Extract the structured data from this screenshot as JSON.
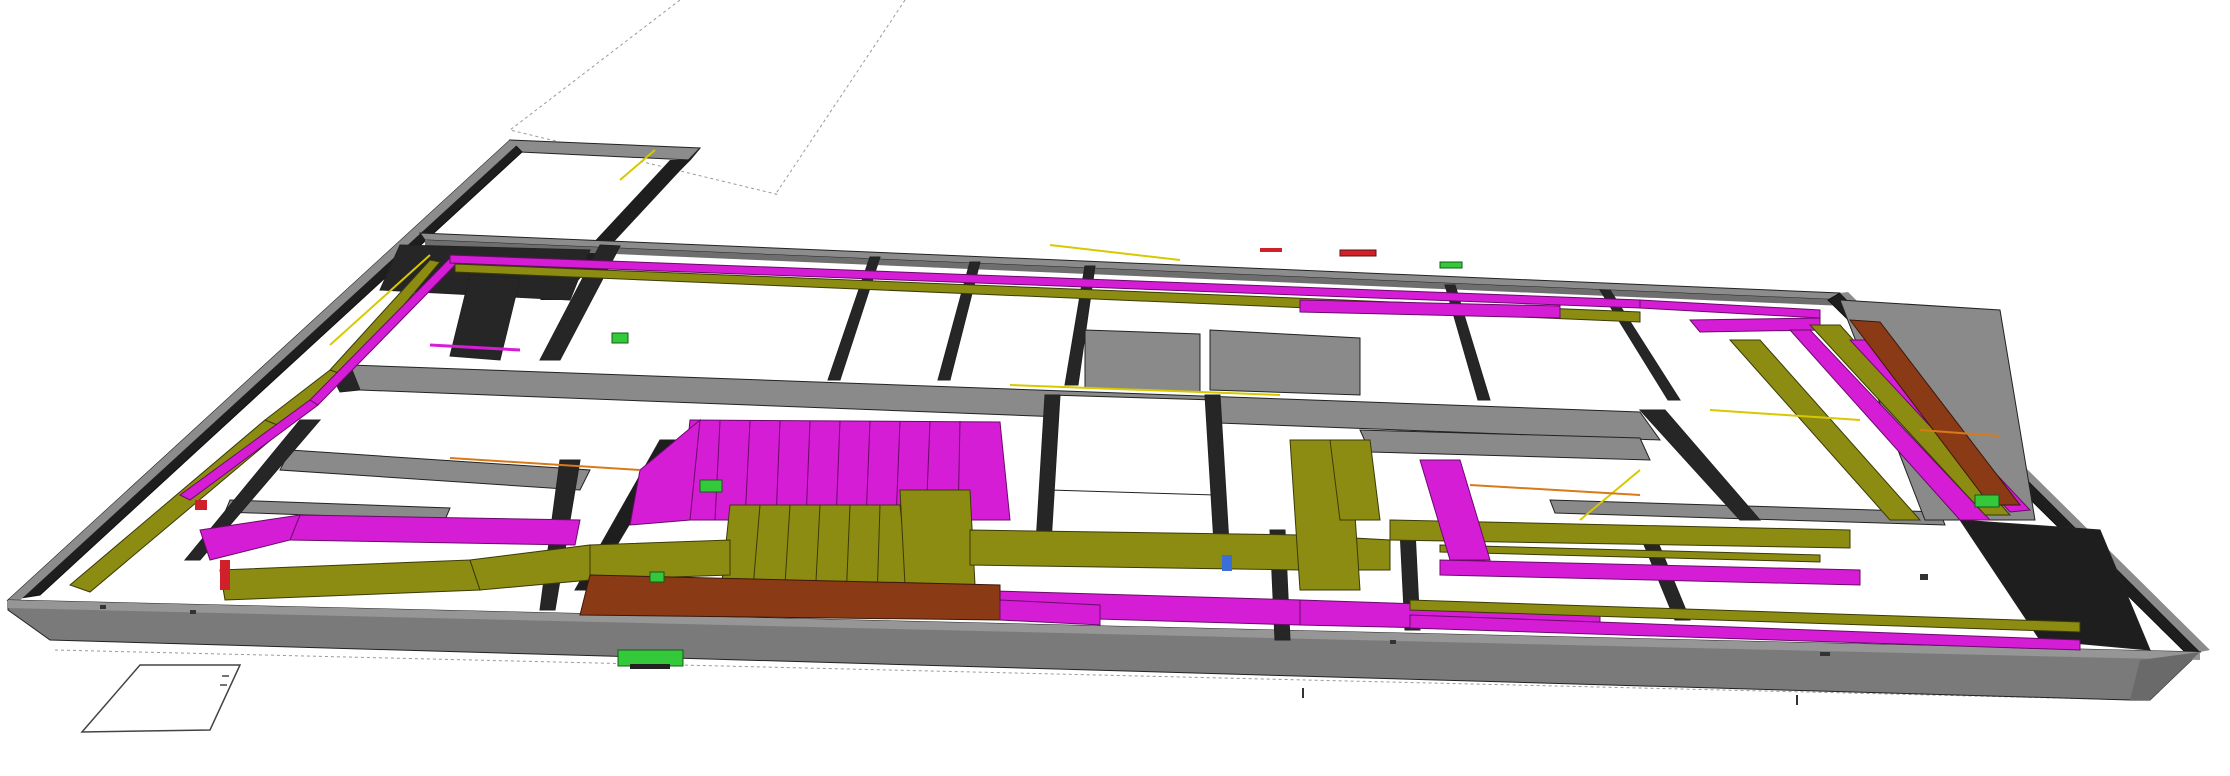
{
  "view": {
    "type": "3d-isometric-model",
    "background": "#ffffff"
  },
  "colors": {
    "wall_top": "#8c8c8c",
    "wall_front": "#7a7a7a",
    "wall_dark": "#1e1e1e",
    "floor": "#ffffff",
    "duct_supply": "#d61dd6",
    "duct_supply_dark": "#a514a5",
    "duct_return": "#8c8c12",
    "duct_return_dark": "#5e5e08",
    "duct_exhaust": "#8a3b16",
    "duct_exhaust_dark": "#5c250c",
    "equipment_green": "#34c93a",
    "equipment_red": "#d0202a",
    "piping_yellow": "#d8c800",
    "piping_orange": "#d87a1a",
    "equipment_blue": "#3a6fd8"
  },
  "legend_items": [],
  "icons": [
    "building-shell-icon",
    "duct-network-icon",
    "equipment-icon"
  ]
}
